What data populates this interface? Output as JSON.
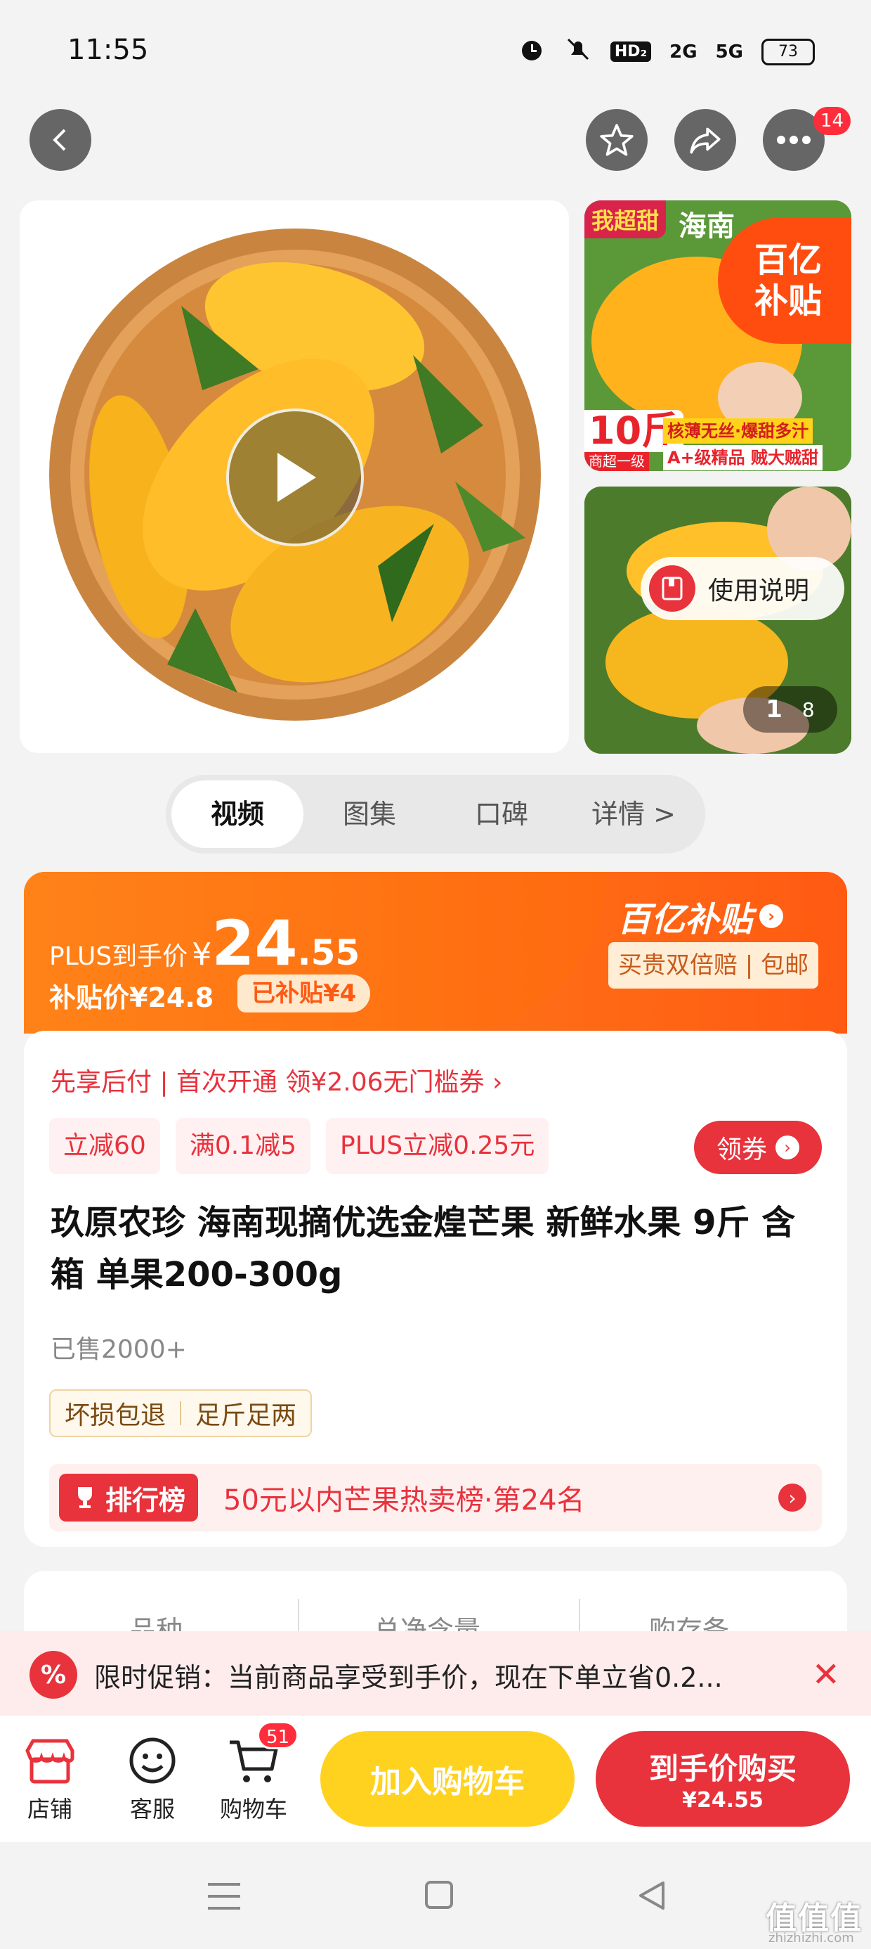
{
  "status": {
    "time": "11:55",
    "net1": "HD₂",
    "net2": "2G",
    "net3": "5G",
    "battery": "73"
  },
  "header": {
    "more_badge": "14"
  },
  "gallery": {
    "thumb1_top_left": "我超甜",
    "thumb1_top": "海南",
    "subsidy_badge_line1": "百亿",
    "subsidy_badge_line2": "补贴",
    "thumb1_weight": "10斤",
    "thumb1_grade": "商超一级",
    "thumb1_features": "核薄无丝·爆甜多汁",
    "thumb1_quality": "A+级精品 贼大贼甜",
    "instructions_label": "使用说明",
    "page_current": "1",
    "page_total": "8"
  },
  "tabs": [
    {
      "label": "视频"
    },
    {
      "label": "图集"
    },
    {
      "label": "口碑"
    },
    {
      "label": "详情 >"
    }
  ],
  "price": {
    "plus_label": "PLUS到手价",
    "currency": "¥",
    "int": "24",
    "dec": ".55",
    "subsidy_price": "补贴价¥24.8",
    "subsidy_amount": "已补贴¥4",
    "brand": "百亿补贴",
    "guarantee": "买贵双倍赔 | 包邮"
  },
  "info": {
    "pay_later": "先享后付 | 首次开通 领¥2.06无门槛券 ›",
    "chips": [
      "立减60",
      "满0.1减5",
      "PLUS立减0.25元"
    ],
    "coupon_button": "领券",
    "title": "玖原农珍 海南现摘优选金煌芒果 新鲜水果 9斤 含箱 单果200-300g",
    "sold": "已售2000+",
    "tags": [
      "坏损包退",
      "足斤足两"
    ],
    "rank_label": "排行榜",
    "rank_text": "50元以内芒果热卖榜·第24名"
  },
  "specs": {
    "col1": "品种",
    "col2": "总净含量",
    "col3": "购存备"
  },
  "promo": {
    "text": "限时促销：当前商品享受到手价，现在下单立省0.2..."
  },
  "bottom": {
    "shop": "店铺",
    "service": "客服",
    "cart": "购物车",
    "cart_badge": "51",
    "add_cart": "加入购物车",
    "buy_label": "到手价购买",
    "buy_price": "¥24.55"
  },
  "watermark": {
    "main": "值值值",
    "url": "zhizhizhi.com"
  },
  "colors": {
    "accent": "#ff5a12",
    "red": "#e8323c",
    "yellow": "#ffd21f"
  }
}
